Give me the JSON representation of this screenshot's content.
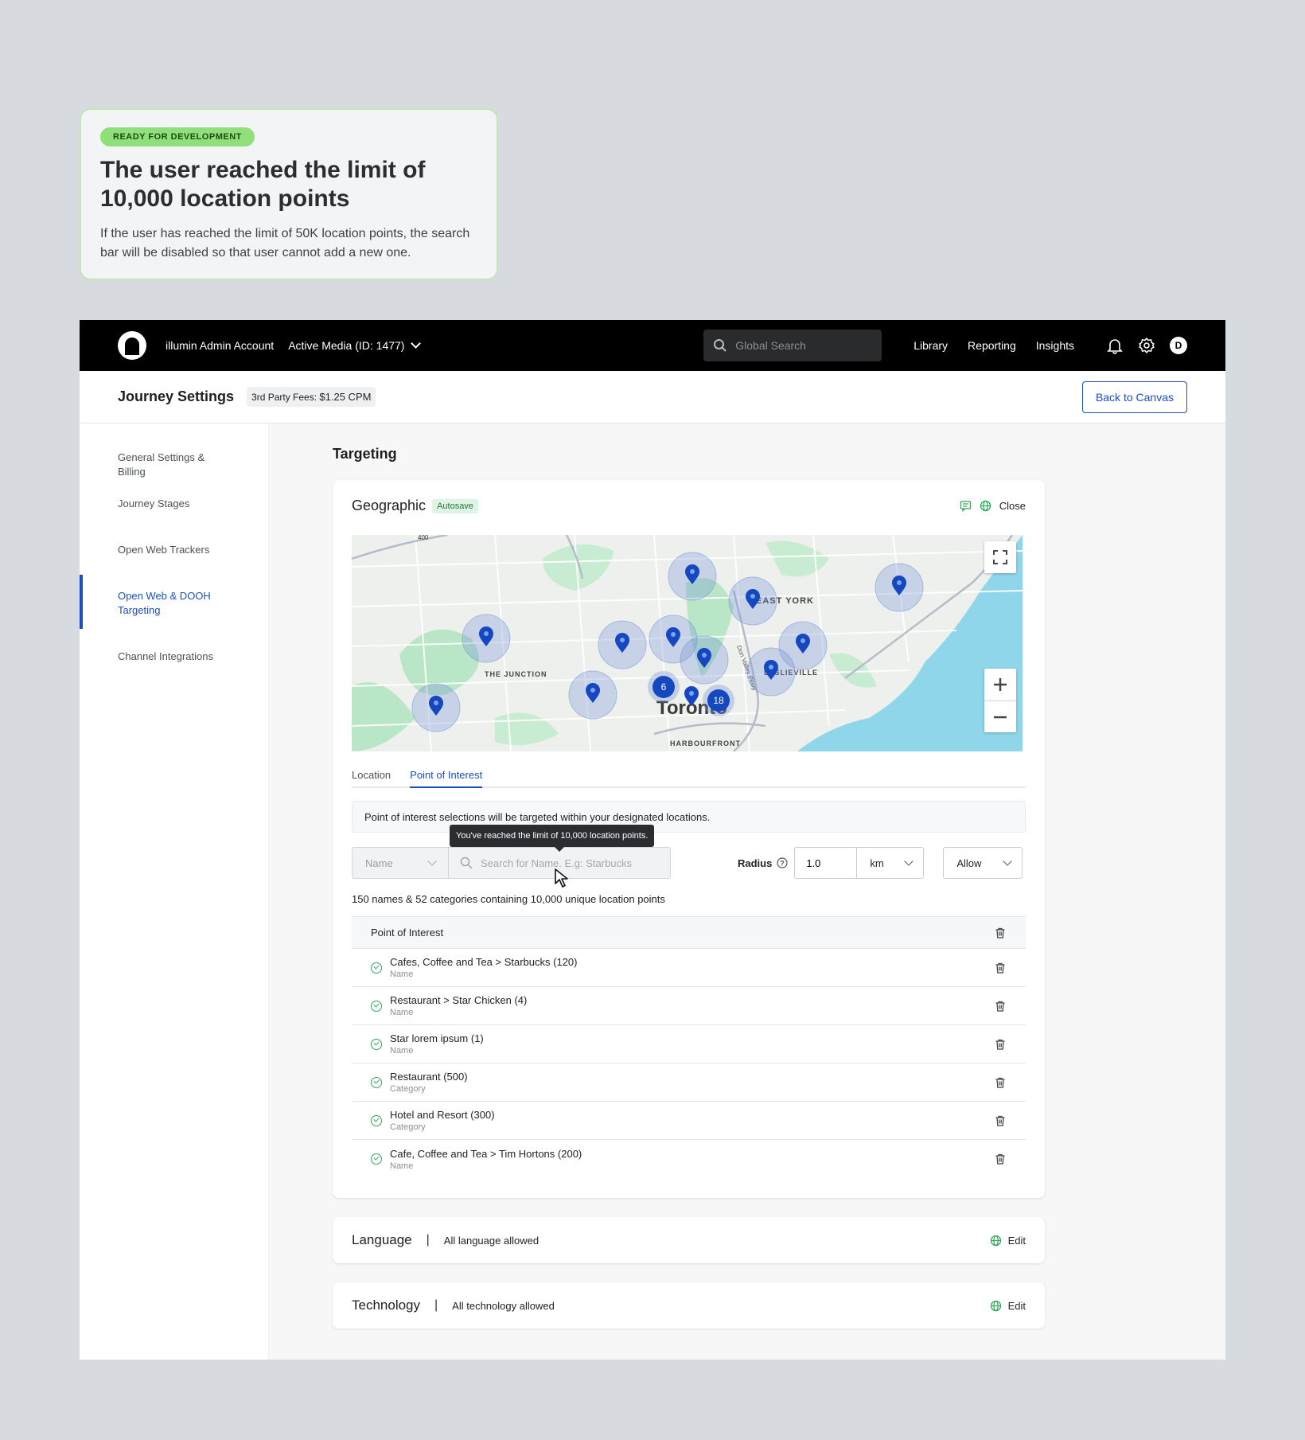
{
  "note": {
    "badge": "READY FOR DEVELOPMENT",
    "title_line1": "The user reached the limit of",
    "title_line2": "10,000 location points",
    "text_line1": "If the user has reached the limit of 50K location points, the search",
    "text_line2": "bar will be disabled so that user cannot add a new one."
  },
  "topbar": {
    "account": "illumin Admin Account",
    "media": "Active Media (ID: 1477)",
    "search_placeholder": "Global Search",
    "links": [
      "Library",
      "Reporting",
      "Insights"
    ],
    "avatar": "D"
  },
  "subheader": {
    "title": "Journey Settings",
    "fees_label": "3rd Party Fees:",
    "fees_value": "$1.25 CPM",
    "back_button": "Back to Canvas"
  },
  "sidebar": {
    "items": [
      "General Settings & Billing",
      "Journey Stages",
      "Open Web Trackers",
      "Open Web & DOOH Targeting",
      "Channel Integrations"
    ],
    "active_index": 3
  },
  "targeting": {
    "title": "Targeting",
    "geographic": {
      "title": "Geographic",
      "badge": "Autosave",
      "close": "Close",
      "map_labels": {
        "junction": "THE JUNCTION",
        "east_york": "EAST YORK",
        "leslieville": "LESLIEVILLE",
        "toronto": "Toronto",
        "harbourfront": "HARBOURFRONT",
        "road": "Don Valley Pkwy",
        "highway": "400",
        "cluster_a": "6",
        "cluster_b": "18"
      },
      "tabs": [
        "Location",
        "Point of Interest"
      ],
      "active_tab": 1,
      "info": "Point of interest selections will be targeted within your designated locations.",
      "tooltip": "You've reached the limit of 10,000 location points.",
      "name_select": "Name",
      "search_placeholder": "Search for Name. E.g: Starbucks",
      "radius_label": "Radius",
      "radius_value": "1.0",
      "unit": "km",
      "allow": "Allow",
      "summary": "150 names & 52 categories containing 10,000 unique location points",
      "table_header": "Point of Interest",
      "rows": [
        {
          "name": "Cafes, Coffee and Tea > Starbucks",
          "count": "(120)",
          "type": "Name"
        },
        {
          "name": "Restaurant > Star Chicken",
          "count": "(4)",
          "type": "Name"
        },
        {
          "name": "Star lorem ipsum",
          "count": "(1)",
          "type": "Name"
        },
        {
          "name": "Restaurant",
          "count": "(500)",
          "type": "Category"
        },
        {
          "name": "Hotel and Resort",
          "count": "(300)",
          "type": "Category"
        },
        {
          "name": "Cafe, Coffee and Tea > Tim Hortons",
          "count": "(200)",
          "type": "Name"
        }
      ]
    },
    "language": {
      "title": "Language",
      "value": "All language allowed",
      "edit": "Edit"
    },
    "technology": {
      "title": "Technology",
      "value": "All technology allowed",
      "edit": "Edit"
    }
  },
  "colors": {
    "accent": "#1a4fbf",
    "success": "#2fa85a",
    "water": "#8fd6ea",
    "park": "#b9e6c6"
  }
}
